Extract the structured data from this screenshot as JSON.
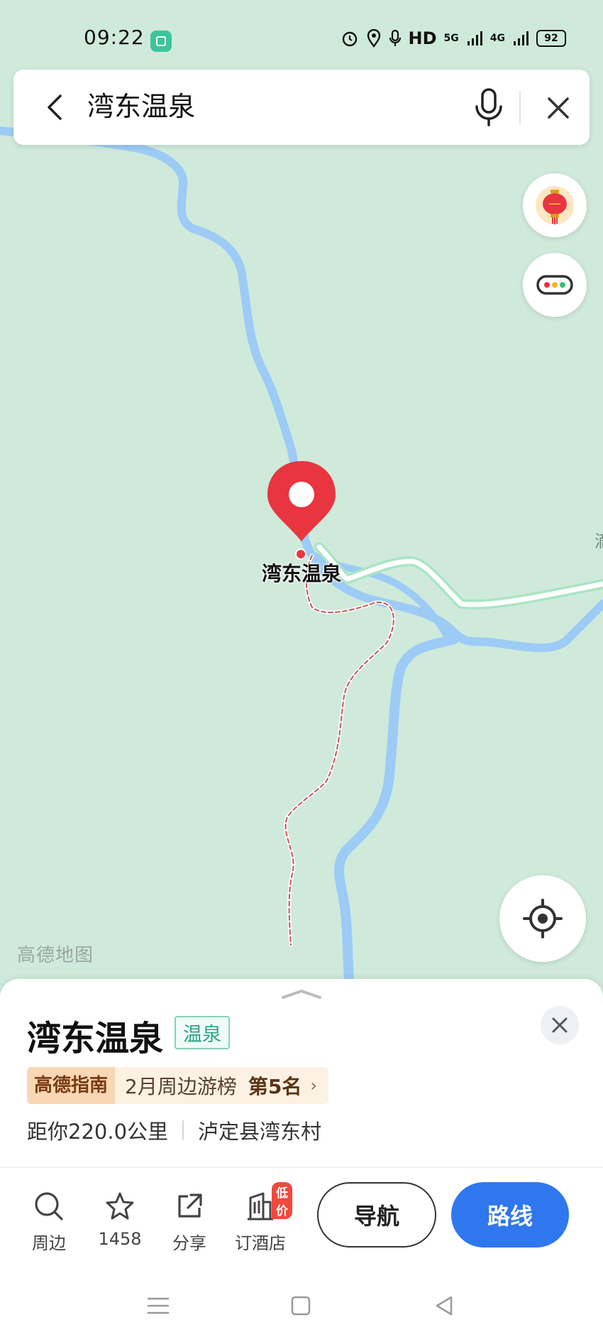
{
  "status_bar": {
    "time": "09:22",
    "network": "HD",
    "signal_1": "5G",
    "signal_2": "4G",
    "battery": "92"
  },
  "search": {
    "query": "湾东温泉"
  },
  "map": {
    "logo": "高德地图",
    "pin_label": "湾东温泉",
    "edge_text": "滴",
    "colors": {
      "land": "#cfeadb",
      "river": "#9ccbf6",
      "road_fill": "#ffffff",
      "road_border": "#a9e5c4",
      "trail": "#c45555",
      "pin": "#e8353f"
    }
  },
  "poi": {
    "name": "湾东温泉",
    "category": "温泉",
    "rank_brand": "高德指南",
    "rank_text": "2月周边游榜",
    "rank_position": "第5名",
    "distance": "距你220.0公里",
    "address": "泸定县湾东村"
  },
  "actions": {
    "nearby": "周边",
    "favorites_count": "1458",
    "share": "分享",
    "hotel": "订酒店",
    "hotel_badge": "低价",
    "navigate": "导航",
    "route": "路线"
  },
  "accent_colors": {
    "primary_blue": "#2f77ee",
    "tag_green": "#2ca388",
    "badge_red": "#f0493e"
  }
}
